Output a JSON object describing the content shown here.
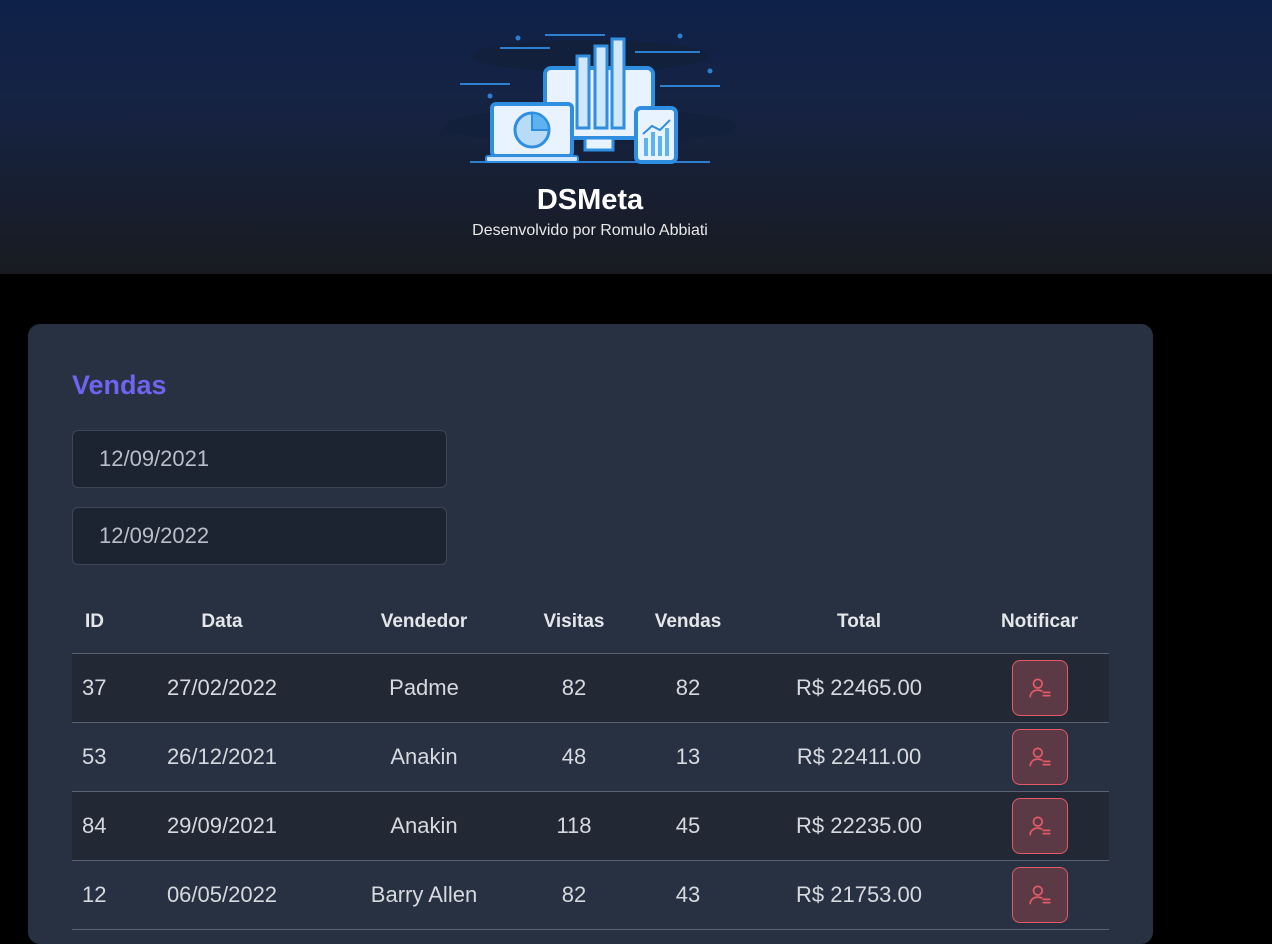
{
  "header": {
    "title": "DSMeta",
    "subtitle": "Desenvolvido por Romulo Abbiati",
    "logo_icon": "dashboard-devices-illustration"
  },
  "sales": {
    "title": "Vendas",
    "date_min": "12/09/2021",
    "date_max": "12/09/2022",
    "columns": [
      "ID",
      "Data",
      "Vendedor",
      "Visitas",
      "Vendas",
      "Total",
      "Notificar"
    ],
    "rows": [
      {
        "id": "37",
        "date": "27/02/2022",
        "seller": "Padme",
        "visits": "82",
        "deals": "82",
        "total": "R$ 22465.00"
      },
      {
        "id": "53",
        "date": "26/12/2021",
        "seller": "Anakin",
        "visits": "48",
        "deals": "13",
        "total": "R$ 22411.00"
      },
      {
        "id": "84",
        "date": "29/09/2021",
        "seller": "Anakin",
        "visits": "118",
        "deals": "45",
        "total": "R$ 22235.00"
      },
      {
        "id": "12",
        "date": "06/05/2022",
        "seller": "Barry Allen",
        "visits": "82",
        "deals": "43",
        "total": "R$ 21753.00"
      }
    ],
    "notify_icon": "user-notify-icon"
  },
  "colors": {
    "accent": "#6e64f0",
    "card": "#283142",
    "notify": "#e35a66"
  }
}
